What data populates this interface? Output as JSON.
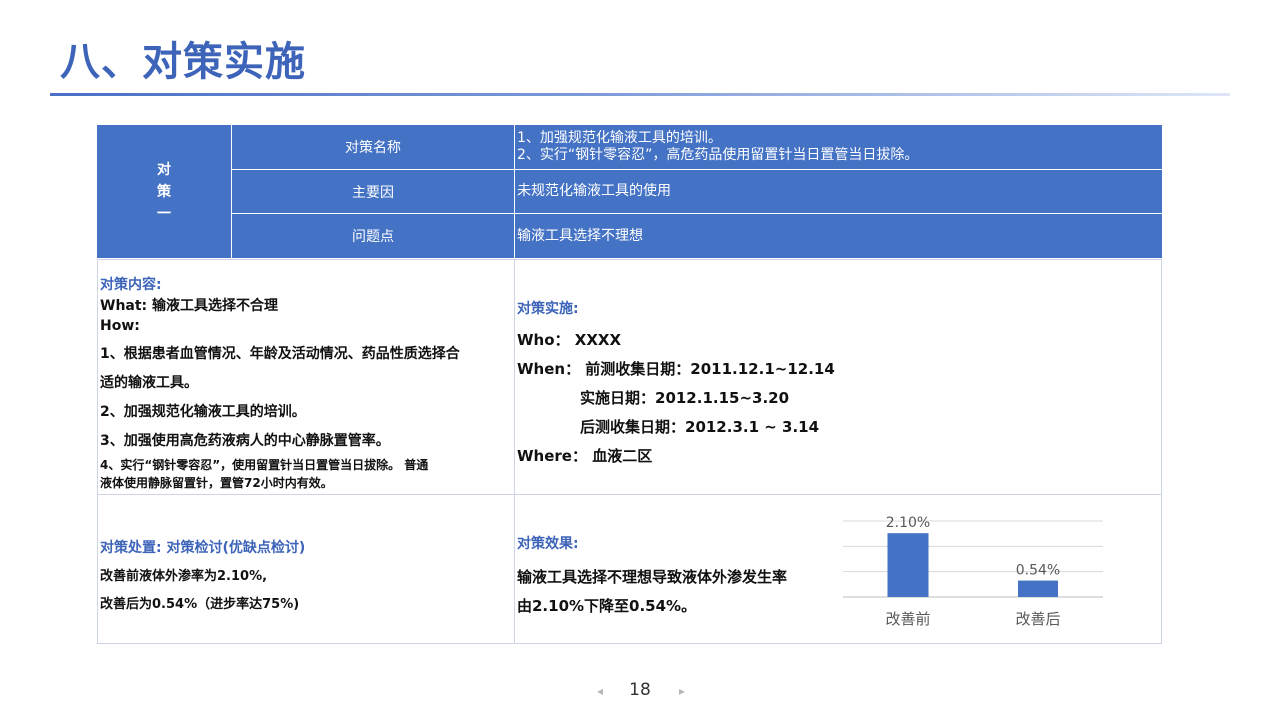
{
  "title": "八、对策实施",
  "table": {
    "row_label": "对\n策\n一",
    "rows": [
      {
        "label": "对策名称",
        "value_lines": [
          "1、加强规范化输液工具的培训。",
          "2、实行“钢针零容忍”，高危药品使用留置针当日置管当日拔除。"
        ]
      },
      {
        "label": "主要因",
        "value_lines": [
          "未规范化输液工具的使用"
        ]
      },
      {
        "label": "问题点",
        "value_lines": [
          "输液工具选择不理想"
        ]
      }
    ]
  },
  "content": {
    "heading": "对策内容:",
    "what": "What:  输液工具选择不合理",
    "how": "How:",
    "item1a": "1、根据患者血管情况、年龄及活动情况、药品性质选择合",
    "item1b": "适的输液工具。",
    "item2": "2、加强规范化输液工具的培训。",
    "item3": "3、加强使用高危药液病人的中心静脉置管率。",
    "item4a": "4、实行“钢针零容忍”，使用留置针当日置管当日拔除。 普通",
    "item4b": "液体使用静脉留置针，置管72小时内有效。"
  },
  "implementation": {
    "heading": "对策实施:",
    "who": "Who：  XXXX",
    "when": "When：  前测收集日期：2011.12.1~12.14",
    "impl_date": "实施日期：2012.1.15~3.20",
    "post_date": "后测收集日期：2012.3.1 ~ 3.14",
    "where": "Where：  血液二区"
  },
  "review": {
    "heading": "对策处置: 对策检讨(优缺点检讨)",
    "line1": "改善前液体外渗率为2.10%,",
    "line2": "改善后为0.54%（进步率达75%)"
  },
  "effect": {
    "heading": "对策效果:",
    "line1": "输液工具选择不理想导致液体外渗发生率",
    "line2": "由2.10%下降至0.54%。"
  },
  "chart_data": {
    "type": "bar",
    "categories": [
      "改善前",
      "改善后"
    ],
    "values": [
      2.1,
      0.54
    ],
    "data_labels": [
      "2.10%",
      "0.54%"
    ],
    "ylim": [
      0,
      2.5
    ],
    "grid": true,
    "bar_color": "#4472c4"
  },
  "footer": {
    "page_number": "18",
    "prev_icon": "◂",
    "next_icon": "▸"
  }
}
